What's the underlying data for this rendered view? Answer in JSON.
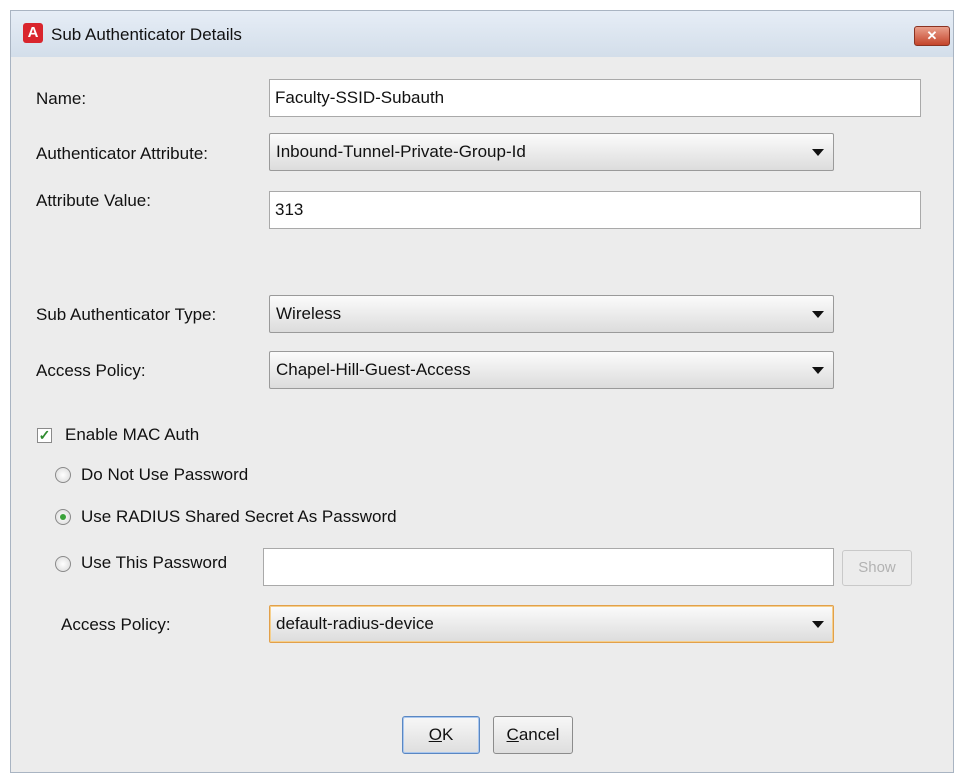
{
  "dialog": {
    "title": "Sub Authenticator Details",
    "close_icon": "close-icon",
    "app_icon_letter": "A"
  },
  "fields": {
    "name_label": "Name:",
    "name_value": "Faculty-SSID-Subauth",
    "auth_attr_label": "Authenticator Attribute:",
    "auth_attr_value": "Inbound-Tunnel-Private-Group-Id",
    "attr_value_label": "Attribute Value:",
    "attr_value_value": "313",
    "sub_type_label": "Sub Authenticator Type:",
    "sub_type_value": "Wireless",
    "access_policy_label": "Access Policy:",
    "access_policy_value": "Chapel-Hill-Guest-Access"
  },
  "mac_auth": {
    "enable_label": "Enable MAC Auth",
    "enabled": true,
    "options": [
      {
        "label": "Do Not Use Password",
        "selected": false
      },
      {
        "label": "Use RADIUS Shared Secret As Password",
        "selected": true
      },
      {
        "label": "Use This Password",
        "selected": false
      }
    ],
    "password_value": "",
    "show_label": "Show",
    "access_policy_label": "Access Policy:",
    "access_policy_value": "default-radius-device"
  },
  "buttons": {
    "ok_mnemonic": "O",
    "ok_rest": "K",
    "cancel_mnemonic": "C",
    "cancel_rest": "ancel"
  },
  "colors": {
    "accent_check": "#2e8b2e",
    "close_red": "#c4442b",
    "focus_orange": "#e2a04a"
  }
}
